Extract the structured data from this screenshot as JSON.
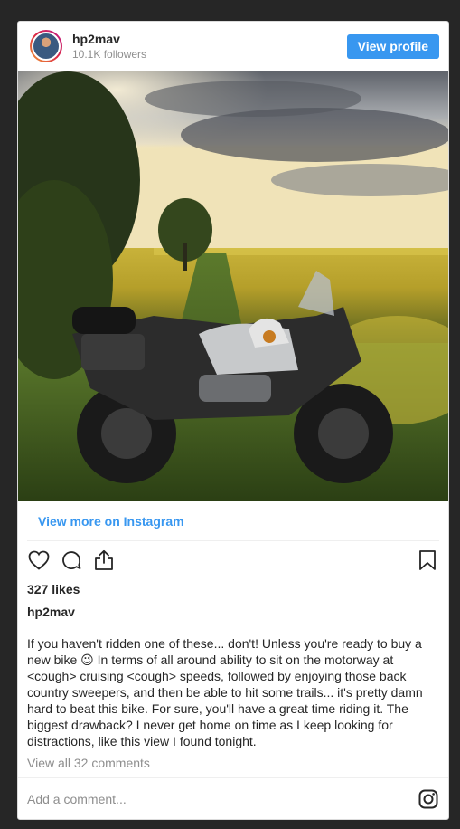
{
  "header": {
    "username": "hp2mav",
    "followers": "10.1K followers",
    "view_profile_label": "View profile"
  },
  "post": {
    "view_more_label": "View more on Instagram",
    "likes": "327 likes",
    "caption_username": "hp2mav",
    "caption": "If you haven't ridden one of these... don't! Unless you're ready to buy a new bike 😉 In terms of all around ability to sit on the motorway at <cough> cruising <cough> speeds, followed by enjoying those back country sweepers, and then be able to hit some trails... it's pretty damn hard to beat this bike. For sure, you'll have a great time riding it. The biggest drawback? I never get home on time as I keep looking for distractions, like this view I found tonight.",
    "comments_link": "View all 32 comments"
  },
  "comment_bar": {
    "placeholder": "Add a comment..."
  },
  "icons": {
    "like": "heart-icon",
    "comment": "comment-bubble-icon",
    "share": "share-icon",
    "save": "bookmark-icon",
    "instagram": "instagram-logo-icon"
  },
  "colors": {
    "accent": "#3897f0",
    "background": "#262626",
    "muted_text": "#8e8e8e"
  }
}
